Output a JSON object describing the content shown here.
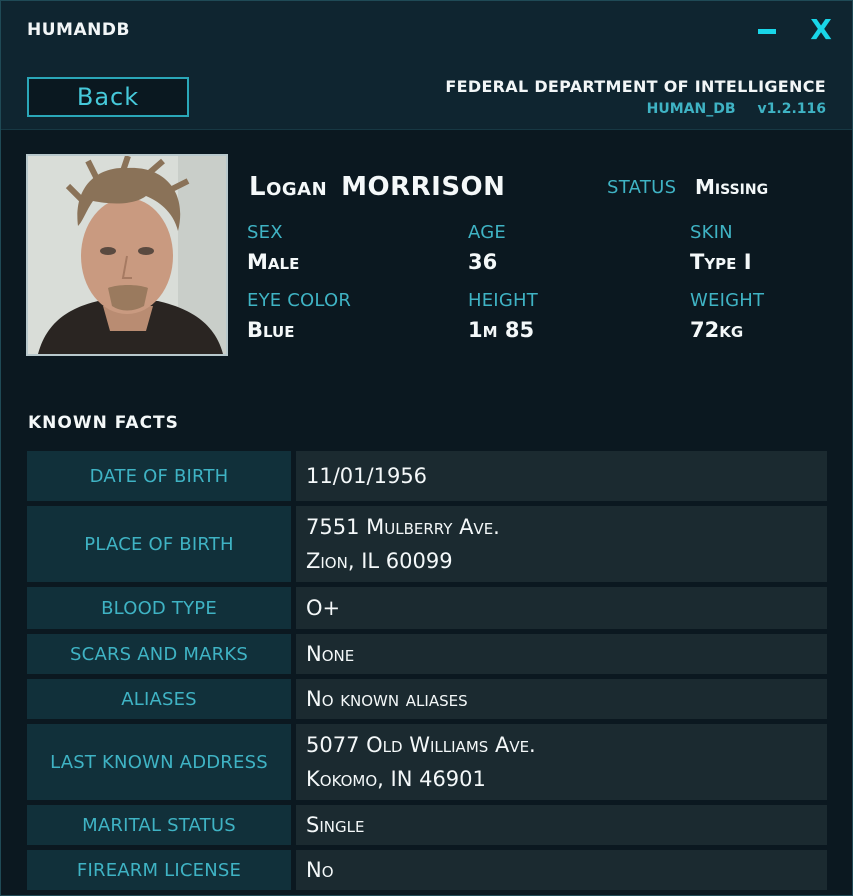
{
  "window": {
    "title": "HUMANDB",
    "minimize_icon": "minimize-icon",
    "close_symbol": "X"
  },
  "header": {
    "back_label": "Back",
    "agency": "FEDERAL DEPARTMENT OF INTELLIGENCE",
    "db_name": "HUMAN_DB",
    "version": "v1.2.116"
  },
  "profile": {
    "first_name": "Logan",
    "last_name": "MORRISON",
    "status_label": "STATUS",
    "status_value": "Missing",
    "fields": [
      {
        "label": "SEX",
        "value": "Male"
      },
      {
        "label": "AGE",
        "value": "36"
      },
      {
        "label": "SKIN",
        "value": "Type I"
      },
      {
        "label": "EYE COLOR",
        "value": "Blue"
      },
      {
        "label": "HEIGHT",
        "value": "1m 85"
      },
      {
        "label": "WEIGHT",
        "value": "72kg"
      }
    ]
  },
  "facts": {
    "title": "KNOWN  FACTS",
    "rows": [
      {
        "label": "DATE OF BIRTH",
        "lines": [
          "11/01/1956"
        ]
      },
      {
        "label": "PLACE OF BIRTH",
        "lines": [
          "7551 Mulberry Ave.",
          "Zion, IL 60099"
        ]
      },
      {
        "label": "BLOOD TYPE",
        "lines": [
          "O+"
        ]
      },
      {
        "label": "SCARS AND MARKS",
        "lines": [
          "None"
        ]
      },
      {
        "label": "ALIASES",
        "lines": [
          "No known aliases"
        ]
      },
      {
        "label": "LAST KNOWN ADDRESS",
        "lines": [
          "5077 Old Williams Ave.",
          "Kokomo, IN 46901"
        ]
      },
      {
        "label": "MARITAL STATUS",
        "lines": [
          "Single"
        ]
      },
      {
        "label": "FIREARM LICENSE",
        "lines": [
          "No"
        ]
      }
    ]
  },
  "colors": {
    "accent": "#3fb3c4",
    "bright_accent": "#19d6e8",
    "background": "#0b1820"
  }
}
